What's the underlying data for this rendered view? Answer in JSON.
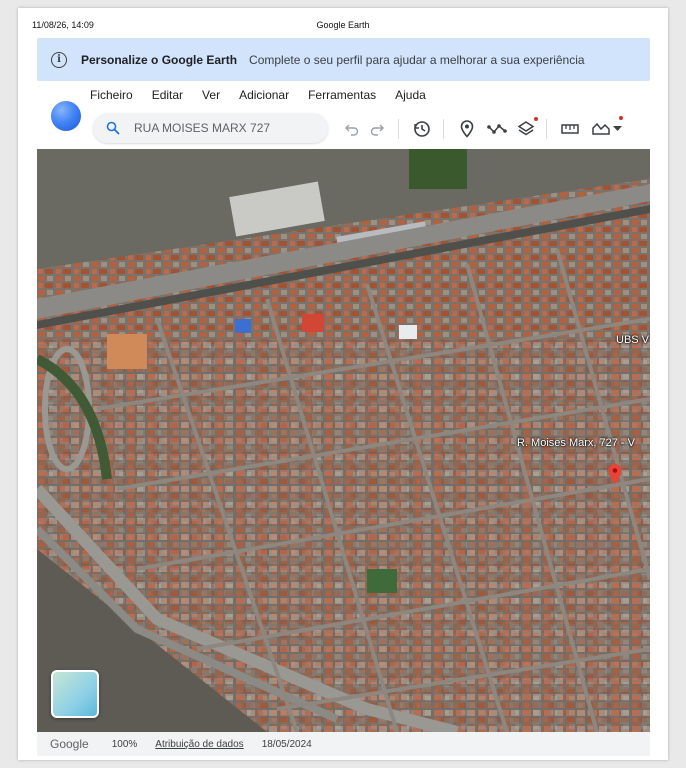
{
  "print": {
    "date": "11/08/26, 14:09",
    "title": "Google Earth"
  },
  "banner": {
    "title": "Personalize o Google Earth",
    "text": "Complete o seu perfil para ajudar a melhorar a sua experiência",
    "icon": "info-icon",
    "color": "#d2e3fc"
  },
  "menu": {
    "items": [
      "Ficheiro",
      "Editar",
      "Ver",
      "Adicionar",
      "Ferramentas",
      "Ajuda"
    ]
  },
  "search": {
    "value": "RUA MOISES MARX 727",
    "icon": "search-icon"
  },
  "toolbar": {
    "icons": [
      "undo-icon",
      "redo-icon",
      "history-icon",
      "placemark-icon",
      "path-icon",
      "layers-icon",
      "ruler-icon",
      "projects-icon",
      "chevron-down-icon"
    ],
    "notification_color": "#d93025"
  },
  "map": {
    "labels": {
      "ubs": "UBS V",
      "place": "R. Moises Marx, 727 - V"
    },
    "pin_color": "#ea4335"
  },
  "status": {
    "brand": "Google",
    "zoom": "100%",
    "attribution": "Atribuição de dados",
    "date": "18/05/2024"
  }
}
